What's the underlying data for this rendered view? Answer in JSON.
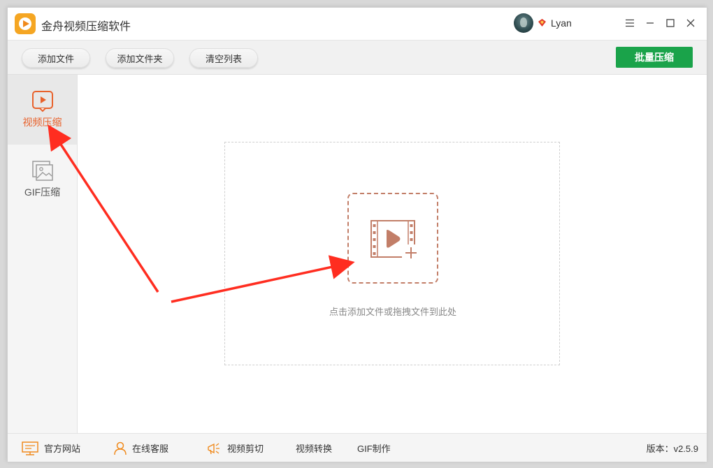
{
  "app": {
    "title": "金舟视频压缩软件",
    "username": "Lyan"
  },
  "toolbar": {
    "add_file": "添加文件",
    "add_folder": "添加文件夹",
    "clear_list": "清空列表",
    "batch_compress": "批量压缩"
  },
  "sidebar": {
    "items": [
      {
        "label": "视频压缩",
        "icon": "video-play-icon",
        "active": true
      },
      {
        "label": "GIF压缩",
        "icon": "image-icon",
        "active": false
      }
    ]
  },
  "dropzone": {
    "hint": "点击添加文件或拖拽文件到此处",
    "icon": "video-add-icon"
  },
  "footer": {
    "website": "官方网站",
    "support": "在线客服",
    "video_cut": "视频剪切",
    "video_convert": "视频转换",
    "gif_make": "GIF制作",
    "version": "版本：v2.5.9"
  },
  "colors": {
    "accent_green": "#1aa34a",
    "accent_orange": "#e8622c",
    "brown": "#c27e68",
    "annotation_red": "#ff2d20"
  }
}
